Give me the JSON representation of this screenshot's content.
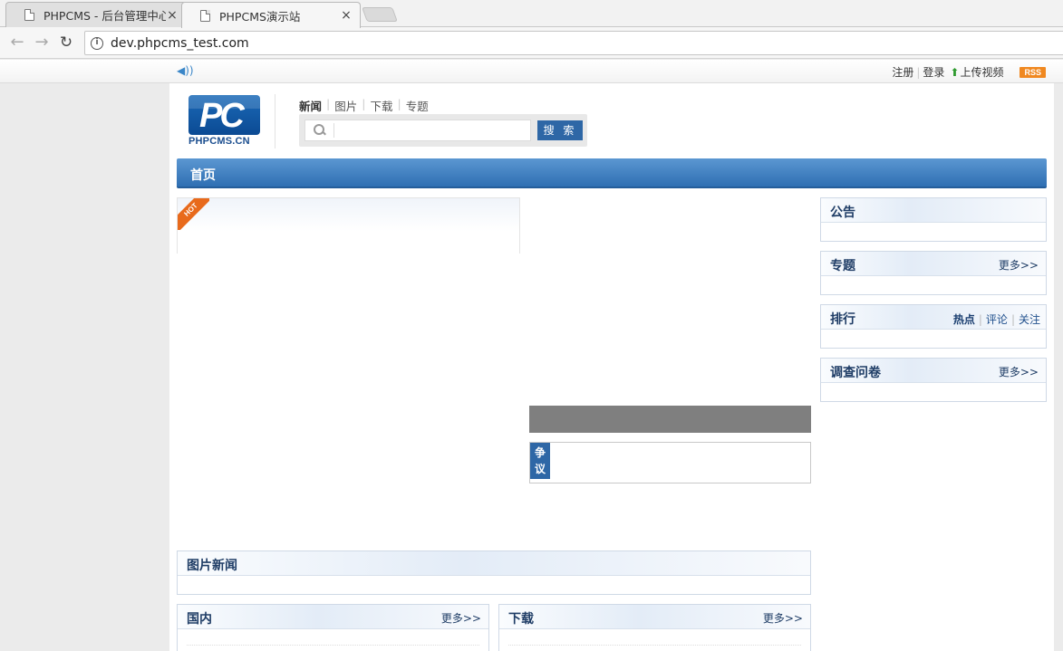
{
  "browser": {
    "tabs": [
      {
        "title": "PHPCMS - 后台管理中心",
        "close": "×",
        "active": false
      },
      {
        "title": "PHPCMS演示站",
        "close": "×",
        "active": true
      }
    ],
    "url": "dev.phpcms_test.com",
    "info_icon": "i",
    "back": "←",
    "forward": "→",
    "reload": "↻"
  },
  "topbar": {
    "speaker_icon": "speaker-icon",
    "register": "注册",
    "login": "登录",
    "upload": "上传视频",
    "rss": "RSS"
  },
  "header": {
    "logo_letters": "PC",
    "logo_sub": "PHPCMS.CN",
    "categories": [
      "新闻",
      "图片",
      "下载",
      "专题"
    ],
    "search_placeholder": "",
    "search_button": "搜 索"
  },
  "nav": {
    "home": "首页"
  },
  "hot": {
    "ribbon": "HOT"
  },
  "dispute": {
    "tag_line1": "争",
    "tag_line2": "议"
  },
  "sidebar": {
    "notice": {
      "title": "公告"
    },
    "special": {
      "title": "专题",
      "more": "更多>>"
    },
    "ranking": {
      "title": "排行",
      "tabs": [
        "热点",
        "评论",
        "关注"
      ]
    },
    "survey": {
      "title": "调查问卷",
      "more": "更多>>"
    }
  },
  "sections": {
    "photo_news": {
      "title": "图片新闻"
    },
    "domestic": {
      "title": "国内",
      "more": "更多>>"
    },
    "download": {
      "title": "下载",
      "more": "更多>>"
    }
  },
  "colors": {
    "accent": "#2e67a6",
    "nav_top": "#5b97d2",
    "nav_bottom": "#2f6fb3",
    "hot": "#e86a1c",
    "rss": "#f08820"
  }
}
